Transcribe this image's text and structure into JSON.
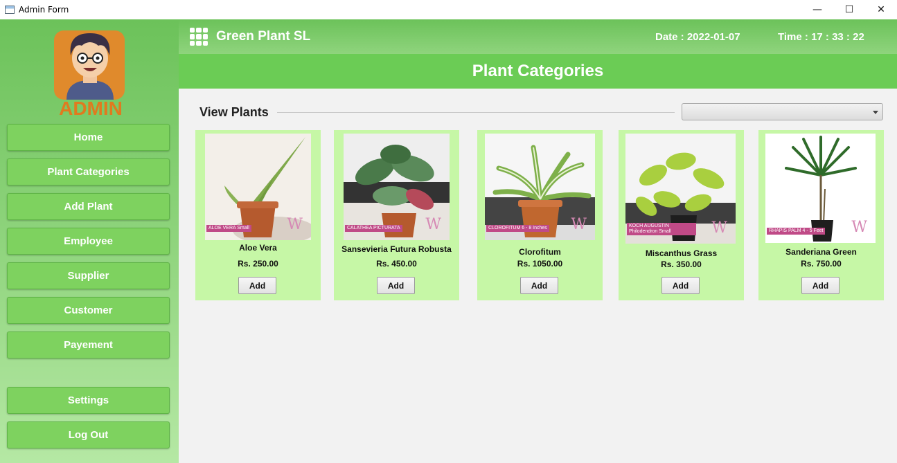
{
  "window": {
    "title": "Admin Form",
    "minimize": "—",
    "maximize": "☐",
    "close": "✕"
  },
  "sidebar": {
    "avatar_text": "ADMIN",
    "items": [
      {
        "label": "Home"
      },
      {
        "label": "Plant Categories"
      },
      {
        "label": "Add Plant"
      },
      {
        "label": "Employee"
      },
      {
        "label": "Supplier"
      },
      {
        "label": "Customer"
      },
      {
        "label": "Payement"
      },
      {
        "label": "Settings"
      },
      {
        "label": "Log Out"
      }
    ]
  },
  "header": {
    "brand": "Green Plant SL",
    "date_label": "Date  : 2022-01-07",
    "time_label": "Time  : 17 : 33 : 22"
  },
  "banner": {
    "title": "Plant Categories"
  },
  "content": {
    "view_title": "View Plants",
    "filter_selected": ""
  },
  "plants": [
    {
      "name": "Aloe Vera",
      "price": "Rs. 250.00",
      "tag": "ALOE VERA Small",
      "button": "Add"
    },
    {
      "name": "Sansevieria Futura Robusta",
      "price": "Rs. 450.00",
      "tag": "CALATHEA PICTURATA",
      "button": "Add"
    },
    {
      "name": "Clorofitum",
      "price": "Rs. 1050.00",
      "tag": "CLOROFITUM 6 - 8 Inches",
      "button": "Add"
    },
    {
      "name": "Miscanthus Grass",
      "price": "Rs. 350.00",
      "tag": "KOCH AUGUSTIN Philodendron Small",
      "button": "Add"
    },
    {
      "name": "Sanderiana Green",
      "price": "Rs. 750.00",
      "tag": "RHAPIS PALM 4 - 5 Feet",
      "button": "Add"
    }
  ],
  "colors": {
    "accent": "#6bcc55",
    "card": "#c6f7a6",
    "tag": "#c04a87"
  }
}
